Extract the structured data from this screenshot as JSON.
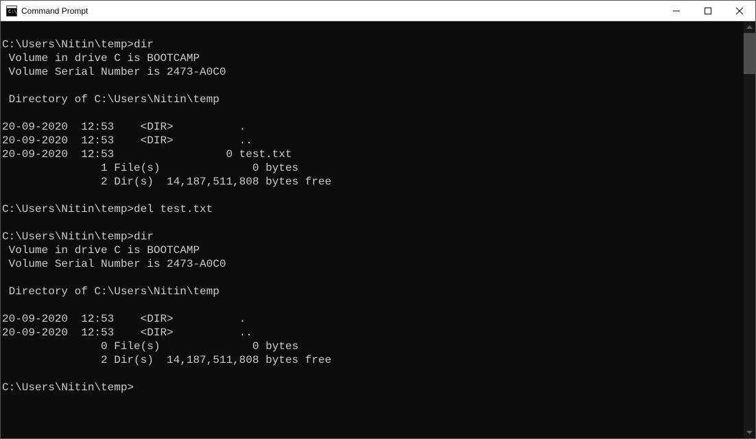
{
  "window": {
    "title": "Command Prompt"
  },
  "terminal": {
    "lines": [
      "",
      "C:\\Users\\Nitin\\temp>dir",
      " Volume in drive C is BOOTCAMP",
      " Volume Serial Number is 2473-A0C0",
      "",
      " Directory of C:\\Users\\Nitin\\temp",
      "",
      "20-09-2020  12:53    <DIR>          .",
      "20-09-2020  12:53    <DIR>          ..",
      "20-09-2020  12:53                 0 test.txt",
      "               1 File(s)              0 bytes",
      "               2 Dir(s)  14,187,511,808 bytes free",
      "",
      "C:\\Users\\Nitin\\temp>del test.txt",
      "",
      "C:\\Users\\Nitin\\temp>dir",
      " Volume in drive C is BOOTCAMP",
      " Volume Serial Number is 2473-A0C0",
      "",
      " Directory of C:\\Users\\Nitin\\temp",
      "",
      "20-09-2020  12:53    <DIR>          .",
      "20-09-2020  12:53    <DIR>          ..",
      "               0 File(s)              0 bytes",
      "               2 Dir(s)  14,187,511,808 bytes free",
      "",
      "C:\\Users\\Nitin\\temp>"
    ]
  }
}
